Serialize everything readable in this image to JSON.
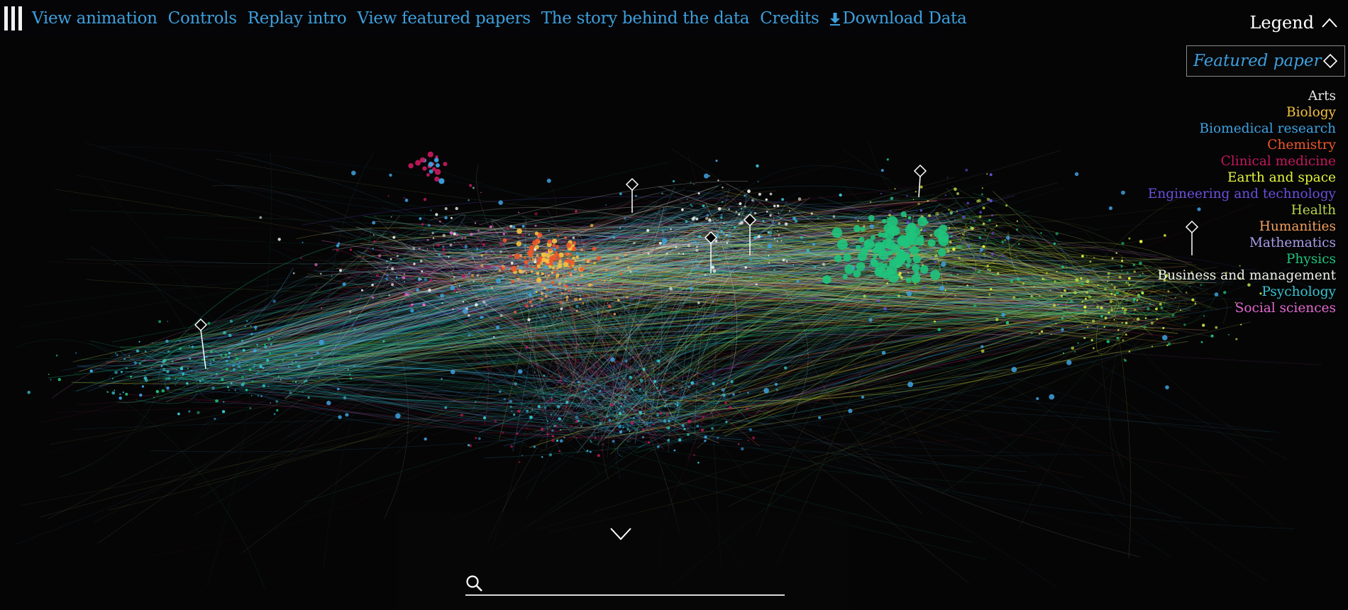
{
  "nav": {
    "items": [
      {
        "label": "View animation"
      },
      {
        "label": "Controls"
      },
      {
        "label": "Replay intro"
      },
      {
        "label": "View featured papers"
      },
      {
        "label": "The story behind the data"
      },
      {
        "label": "Credits"
      },
      {
        "label": "Download Data"
      }
    ]
  },
  "legend": {
    "title": "Legend",
    "featured_label": "Featured paper",
    "items": [
      {
        "label": "Arts",
        "color": "#e6e6e6"
      },
      {
        "label": "Biology",
        "color": "#f5c242"
      },
      {
        "label": "Biomedical research",
        "color": "#3ea2e0"
      },
      {
        "label": "Chemistry",
        "color": "#f0582a"
      },
      {
        "label": "Clinical medicine",
        "color": "#c2185b"
      },
      {
        "label": "Earth and space",
        "color": "#e4f53c"
      },
      {
        "label": "Engineering and technology",
        "color": "#6a4fdc"
      },
      {
        "label": "Health",
        "color": "#b5d34a"
      },
      {
        "label": "Humanities",
        "color": "#f2a05c"
      },
      {
        "label": "Mathematics",
        "color": "#a99de8"
      },
      {
        "label": "Physics",
        "color": "#1fc47c"
      },
      {
        "label": "Business and management",
        "color": "#eef2e6"
      },
      {
        "label": "Psychology",
        "color": "#37c5d0"
      },
      {
        "label": "Social sciences",
        "color": "#e269d0"
      }
    ]
  },
  "icons": {
    "menu": "menu-bars-icon",
    "download": "download-arrow-icon",
    "legend_toggle": "chevron-up-icon",
    "featured": "diamond-icon",
    "expand": "chevron-down-icon",
    "search": "search-icon"
  },
  "search": {
    "placeholder": "",
    "value": ""
  },
  "featured_markers": 6
}
